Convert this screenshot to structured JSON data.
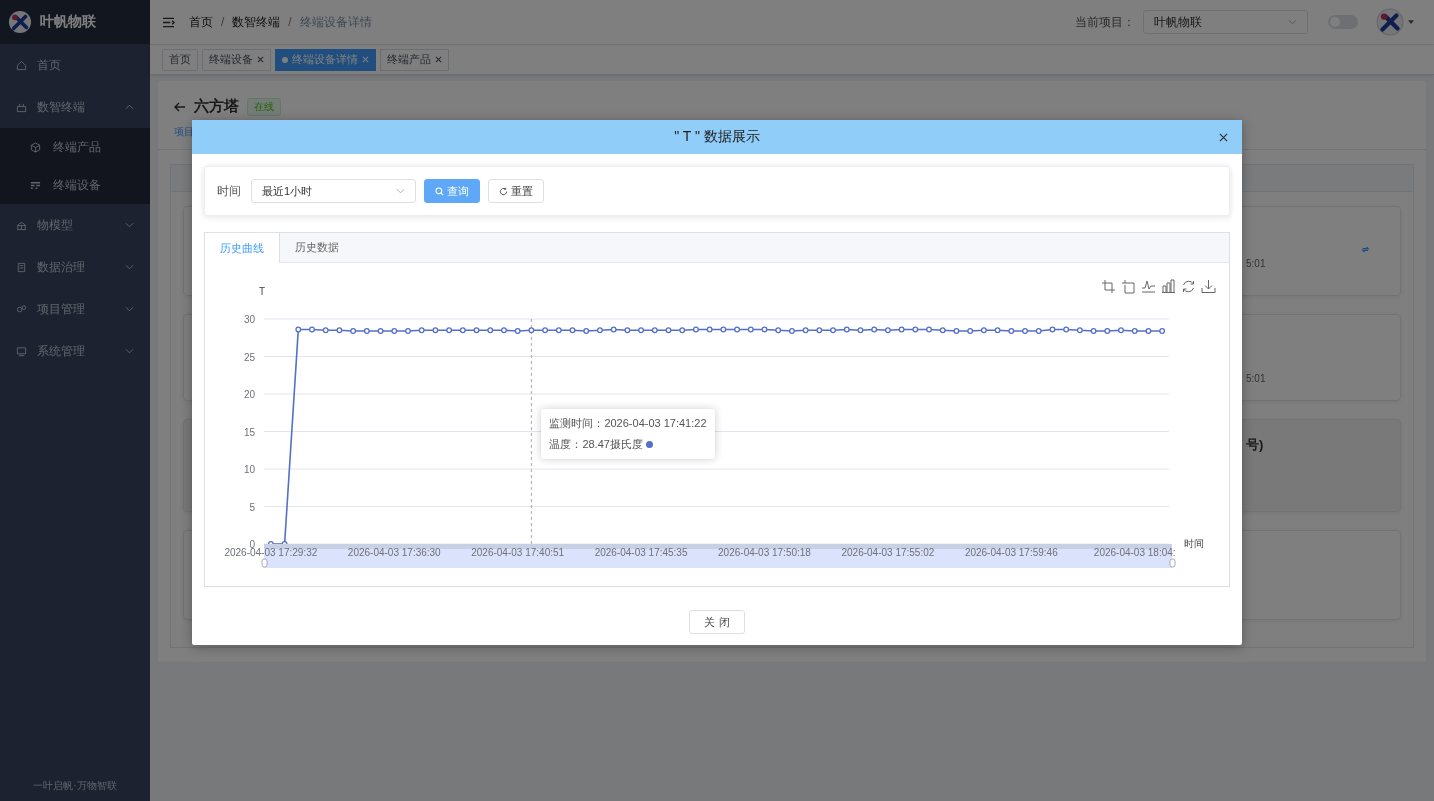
{
  "sidebar": {
    "brand": "叶帆物联",
    "items": [
      {
        "label": "首页",
        "kind": "link"
      },
      {
        "label": "数智终端",
        "kind": "group",
        "expanded": true,
        "children": [
          {
            "label": "终端产品"
          },
          {
            "label": "终端设备"
          }
        ]
      },
      {
        "label": "物模型",
        "kind": "group",
        "expanded": false
      },
      {
        "label": "数据治理",
        "kind": "group",
        "expanded": false
      },
      {
        "label": "项目管理",
        "kind": "group",
        "expanded": false
      },
      {
        "label": "系统管理",
        "kind": "group",
        "expanded": false
      }
    ],
    "footer": "一叶启帆·万物智联"
  },
  "header": {
    "breadcrumb": [
      "首页",
      "数智终端",
      "终端设备详情"
    ],
    "separator": "/",
    "project_label": "当前项目：",
    "project": "叶帆物联",
    "switch_on": false
  },
  "tags": [
    {
      "label": "首页",
      "closable": false,
      "selected": false
    },
    {
      "label": "终端设备",
      "closable": true,
      "selected": false
    },
    {
      "label": "终端设备详情",
      "closable": true,
      "selected": true
    },
    {
      "label": "终端产品",
      "closable": true,
      "selected": false
    }
  ],
  "page": {
    "title": "六方塔",
    "status": "在线",
    "link": "项目",
    "cards": [
      {
        "kind": "action-card",
        "text": "5:01"
      },
      {
        "kind": "card",
        "text": "5:01"
      },
      {
        "kind": "panel",
        "text": "号)"
      }
    ]
  },
  "dialog": {
    "title": "\" T \" 数据展示",
    "query": {
      "label": "时间",
      "range": "最近1小时",
      "search": "查询",
      "reset": "重置"
    },
    "tabs": [
      {
        "label": "历史曲线",
        "selected": true
      },
      {
        "label": "历史数据",
        "selected": false
      }
    ],
    "axis_labels": [
      "2026-04-03 17:29:32",
      "2026-04-03 17:36:30",
      "2026-04-03 17:40:51",
      "2026-04-03 17:45:35",
      "2026-04-03 17:50:18",
      "2026-04-03 17:55:02",
      "2026-04-03 17:59:46",
      "2026-04-03 18:04:"
    ],
    "chart_data": {
      "type": "line",
      "xlabel": "时间",
      "ylabel": "T",
      "ylim": [
        0,
        30
      ],
      "yticks": [
        0,
        5,
        10,
        15,
        20,
        25,
        30
      ],
      "grid": true,
      "series": [
        {
          "name": "温度",
          "color": "#5470c6",
          "marker": "circle",
          "values": [
            0,
            0,
            28.6,
            28.6,
            28.5,
            28.5,
            28.4,
            28.4,
            28.4,
            28.4,
            28.4,
            28.5,
            28.5,
            28.5,
            28.5,
            28.5,
            28.5,
            28.5,
            28.4,
            28.5,
            28.5,
            28.5,
            28.5,
            28.4,
            28.5,
            28.6,
            28.5,
            28.5,
            28.5,
            28.5,
            28.5,
            28.6,
            28.6,
            28.6,
            28.6,
            28.6,
            28.6,
            28.5,
            28.4,
            28.5,
            28.5,
            28.5,
            28.6,
            28.5,
            28.6,
            28.5,
            28.6,
            28.6,
            28.6,
            28.5,
            28.4,
            28.4,
            28.5,
            28.5,
            28.4,
            28.4,
            28.4,
            28.6,
            28.6,
            28.5,
            28.4,
            28.4,
            28.5,
            28.4,
            28.4,
            28.4
          ]
        }
      ]
    },
    "tooltip": {
      "time": "监测时间：2026-04-03 17:41:22",
      "sep": "：",
      "value": "28.47摄氏度"
    },
    "close": "关 闭"
  }
}
